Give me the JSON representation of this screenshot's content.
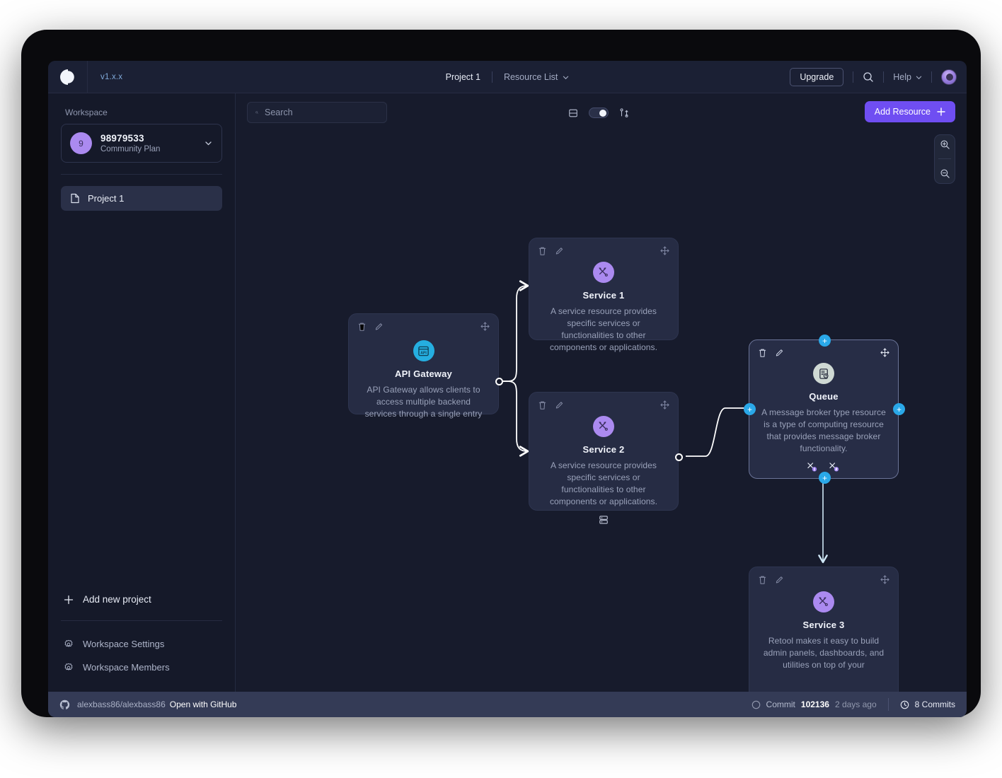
{
  "header": {
    "logo_icon": "app-logo-icon",
    "version": "v1.x.x",
    "project_name": "Project 1",
    "resource_list_label": "Resource List",
    "upgrade_label": "Upgrade",
    "search_icon": "search-icon",
    "help_label": "Help",
    "avatar_icon": "user-avatar"
  },
  "sidebar": {
    "workspace_label": "Workspace",
    "workspace": {
      "initial": "9",
      "name": "98979533",
      "plan": "Community Plan",
      "chevron_icon": "chevron-down-icon"
    },
    "projects": [
      {
        "label": "Project 1",
        "icon": "file-icon"
      }
    ],
    "add_project_label": "Add new project",
    "links": [
      {
        "label": "Workspace Settings",
        "icon": "gear-icon"
      },
      {
        "label": "Workspace Members",
        "icon": "gear-icon"
      }
    ]
  },
  "toolbar": {
    "search_placeholder": "Search",
    "search_value": "",
    "layout_icon": "panel-layout-icon",
    "toggle_on": true,
    "sort_icon": "sort-branch-icon",
    "add_resource_label": "Add Resource",
    "zoom_in_icon": "zoom-in-icon",
    "zoom_out_icon": "zoom-out-icon"
  },
  "canvas": {
    "nodes": [
      {
        "id": "api-gateway",
        "title": "API Gateway",
        "desc": "API Gateway allows clients to access multiple backend services through a single entry",
        "icon": "api-icon",
        "icon_color": "#25aee0",
        "selected": false
      },
      {
        "id": "service-1",
        "title": "Service 1",
        "desc": "A service resource provides specific services or functionalities to other components or applications.",
        "icon": "tools-icon",
        "icon_color": "#ab8af0",
        "selected": false
      },
      {
        "id": "service-2",
        "title": "Service 2",
        "desc": "A service resource provides specific services or functionalities to other components or applications.",
        "icon": "tools-icon",
        "icon_color": "#ab8af0",
        "selected": false,
        "footer_icons": [
          "queue-icon"
        ]
      },
      {
        "id": "queue",
        "title": "Queue",
        "desc": "A message broker type resource is a type of computing resource that provides message broker functionality.",
        "icon": "queue-icon",
        "icon_color": "#cfd9d4",
        "selected": true,
        "footer_icons": [
          "service-badge-icon",
          "service-badge-icon"
        ]
      },
      {
        "id": "service-3",
        "title": "Service 3",
        "desc": "Retool makes it easy to build admin panels, dashboards, and utilities on top of your",
        "icon": "tools-icon",
        "icon_color": "#ab8af0",
        "selected": false
      }
    ],
    "node_actions": {
      "delete_icon": "trash-icon",
      "edit_icon": "pencil-icon",
      "move_icon": "move-icon"
    },
    "port_label": "+",
    "cursor_icon": "pointer-cursor-icon"
  },
  "statusbar": {
    "github_icon": "github-icon",
    "repo": "alexbass86/alexbass86",
    "open_with": "Open with GitHub",
    "commit_label": "Commit",
    "commit_hash": "102136",
    "commit_time": "2 days ago",
    "commits_count": "8 Commits",
    "history_icon": "clock-icon"
  },
  "colors": {
    "accent": "#6f4ef2",
    "port": "#2aa8e8",
    "purple": "#ab8af0",
    "blue": "#25aee0"
  }
}
